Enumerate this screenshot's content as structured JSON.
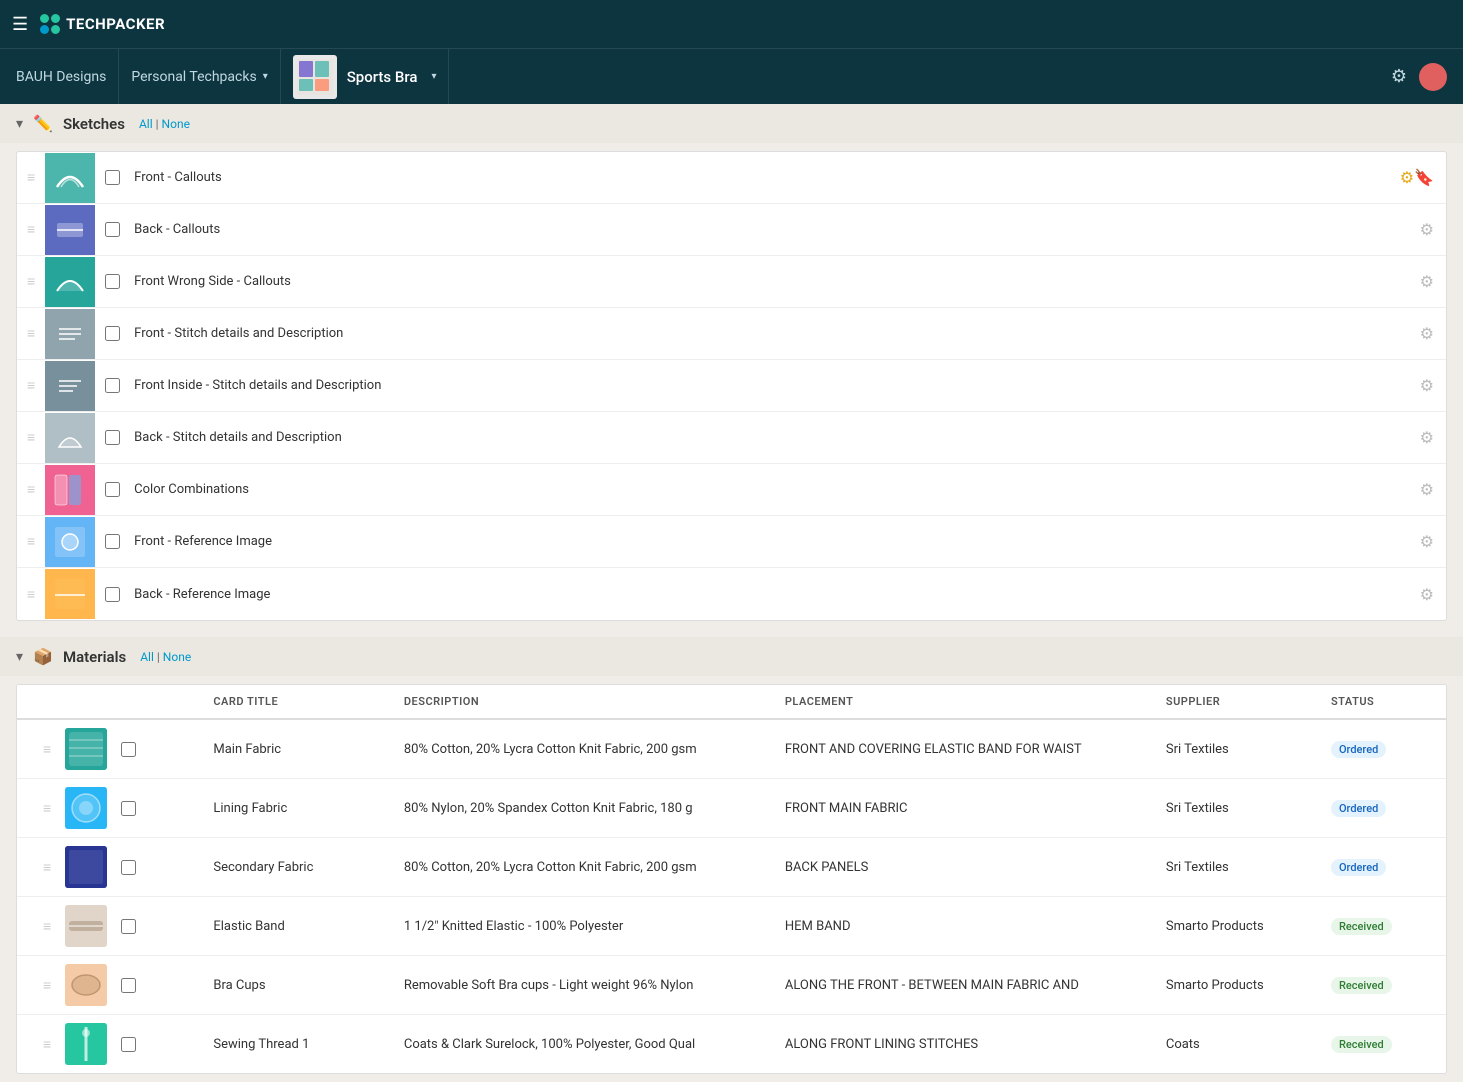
{
  "app": {
    "name": "TECHPACKER",
    "hamburger_label": "☰"
  },
  "breadcrumb": {
    "company": "BAUH Designs",
    "collection_label": "Personal Techpacks",
    "product_title": "Sports Bra",
    "settings_icon": "⚙",
    "chevron": "▾"
  },
  "sketches_section": {
    "title": "Sketches",
    "all_label": "All",
    "pipe": "|",
    "none_label": "None",
    "items": [
      {
        "id": 1,
        "name": "Front - Callouts",
        "thumb_color": "#4db6ac",
        "settings_highlighted": true
      },
      {
        "id": 2,
        "name": "Back - Callouts",
        "thumb_color": "#5c6bc0",
        "settings_highlighted": false
      },
      {
        "id": 3,
        "name": "Front Wrong Side - Callouts",
        "thumb_color": "#26a69a",
        "settings_highlighted": false
      },
      {
        "id": 4,
        "name": "Front - Stitch details and Description",
        "thumb_color": "#90a4ae",
        "settings_highlighted": false
      },
      {
        "id": 5,
        "name": "Front Inside - Stitch details and Description",
        "thumb_color": "#78909c",
        "settings_highlighted": false
      },
      {
        "id": 6,
        "name": "Back - Stitch details and Description",
        "thumb_color": "#b0bec5",
        "settings_highlighted": false
      },
      {
        "id": 7,
        "name": "Color Combinations",
        "thumb_color": "#f06292",
        "settings_highlighted": false
      },
      {
        "id": 8,
        "name": "Front - Reference Image",
        "thumb_color": "#64b5f6",
        "settings_highlighted": false
      },
      {
        "id": 9,
        "name": "Back - Reference Image",
        "thumb_color": "#ffb74d",
        "settings_highlighted": false
      }
    ]
  },
  "materials_section": {
    "title": "Materials",
    "all_label": "All",
    "pipe": "|",
    "none_label": "None",
    "columns": {
      "title": "Card Title",
      "description": "DESCRIPTION",
      "placement": "PLACEMENT",
      "supplier": "SUPPLIER",
      "status": "STATUS"
    },
    "items": [
      {
        "id": 1,
        "name": "Main Fabric",
        "thumb_color": "#26a69a",
        "description": "80% Cotton, 20% Lycra Cotton Knit Fabric, 200 gsm",
        "placement": "FRONT AND COVERING ELASTIC BAND FOR WAIST",
        "supplier": "Sri Textiles",
        "status": "Ordered",
        "status_type": "ordered"
      },
      {
        "id": 2,
        "name": "Lining Fabric",
        "thumb_color": "#29b6f6",
        "description": "80% Nylon, 20% Spandex Cotton Knit Fabric, 180 g",
        "placement": "FRONT MAIN FABRIC",
        "supplier": "Sri Textiles",
        "status": "Ordered",
        "status_type": "ordered"
      },
      {
        "id": 3,
        "name": "Secondary Fabric",
        "thumb_color": "#283593",
        "description": "80% Cotton, 20% Lycra Cotton Knit Fabric, 200 gsm",
        "placement": "BACK PANELS",
        "supplier": "Sri Textiles",
        "status": "Ordered",
        "status_type": "ordered"
      },
      {
        "id": 4,
        "name": "Elastic Band",
        "thumb_color": "#e0d5c8",
        "description": "1 1/2\" Knitted Elastic - 100% Polyester",
        "placement": "HEM BAND",
        "supplier": "Smarto Products",
        "status": "Received",
        "status_type": "received"
      },
      {
        "id": 5,
        "name": "Bra Cups",
        "thumb_color": "#f5cba7",
        "description": "Removable Soft Bra cups - Light weight 96% Nylon",
        "placement": "ALONG THE FRONT - BETWEEN MAIN FABRIC AND",
        "supplier": "Smarto Products",
        "status": "Received",
        "status_type": "received"
      },
      {
        "id": 6,
        "name": "Sewing Thread 1",
        "thumb_color": "#26c6a0",
        "description": "Coats & Clark Surelock, 100% Polyester, Good Qual",
        "placement": "ALONG FRONT LINING STITCHES",
        "supplier": "Coats",
        "status": "Received",
        "status_type": "received"
      }
    ]
  }
}
